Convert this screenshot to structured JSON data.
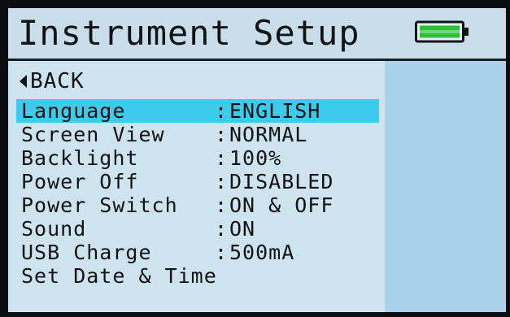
{
  "title": "Instrument Setup",
  "battery": {
    "icon": "battery-icon",
    "fill_color": "#2fbf3a",
    "level": 1.0
  },
  "back": {
    "icon": "back-triangle-icon",
    "label": "BACK"
  },
  "separator": ":",
  "menu": [
    {
      "label": "Language",
      "value": "ENGLISH",
      "selected": true
    },
    {
      "label": "Screen View",
      "value": "NORMAL",
      "selected": false
    },
    {
      "label": "Backlight",
      "value": "100%",
      "selected": false
    },
    {
      "label": "Power Off",
      "value": "DISABLED",
      "selected": false
    },
    {
      "label": "Power Switch",
      "value": "ON & OFF",
      "selected": false
    },
    {
      "label": "Sound",
      "value": "ON",
      "selected": false
    },
    {
      "label": "USB Charge",
      "value": "500mA",
      "selected": false
    },
    {
      "label": "Set Date & Time",
      "value": "",
      "selected": false
    }
  ],
  "colors": {
    "screen_bg": "#cde3ee",
    "highlight": "#3ccbea",
    "side_panel": "#a9d1ea",
    "text": "#111417"
  }
}
